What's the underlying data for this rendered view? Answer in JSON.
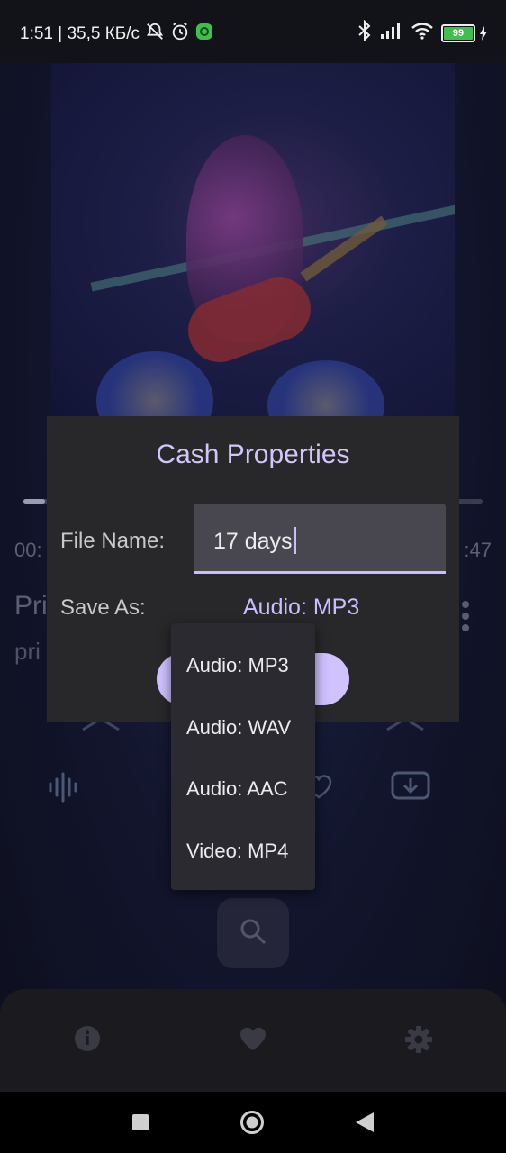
{
  "status_bar": {
    "time_speed": "1:51 | 35,5 КБ/с",
    "battery": "99"
  },
  "player": {
    "elapsed": "00:",
    "duration": ":47",
    "title": "Pri",
    "artist": "pri"
  },
  "dialog": {
    "title": "Cash Properties",
    "file_name_label": "File Name:",
    "file_name_value": "17 days",
    "save_as_label": "Save As:",
    "save_as_value": "Audio: MP3"
  },
  "dropdown": {
    "options": [
      "Audio: MP3",
      "Audio: WAV",
      "Audio: AAC",
      "Video: MP4"
    ]
  },
  "colors": {
    "accent": "#cabeff",
    "dialog_bg": "#28282b",
    "nav_bg": "#1b1b1f"
  },
  "icons": [
    "bell-off-icon",
    "alarm-icon",
    "bluetooth-icon",
    "signal-icon",
    "wifi-icon",
    "battery-icon",
    "more-vert-icon",
    "equalizer-icon",
    "heart-outline-icon",
    "download-icon",
    "search-icon",
    "info-icon",
    "heart-icon",
    "settings-icon",
    "recents-icon",
    "home-icon",
    "back-icon"
  ]
}
